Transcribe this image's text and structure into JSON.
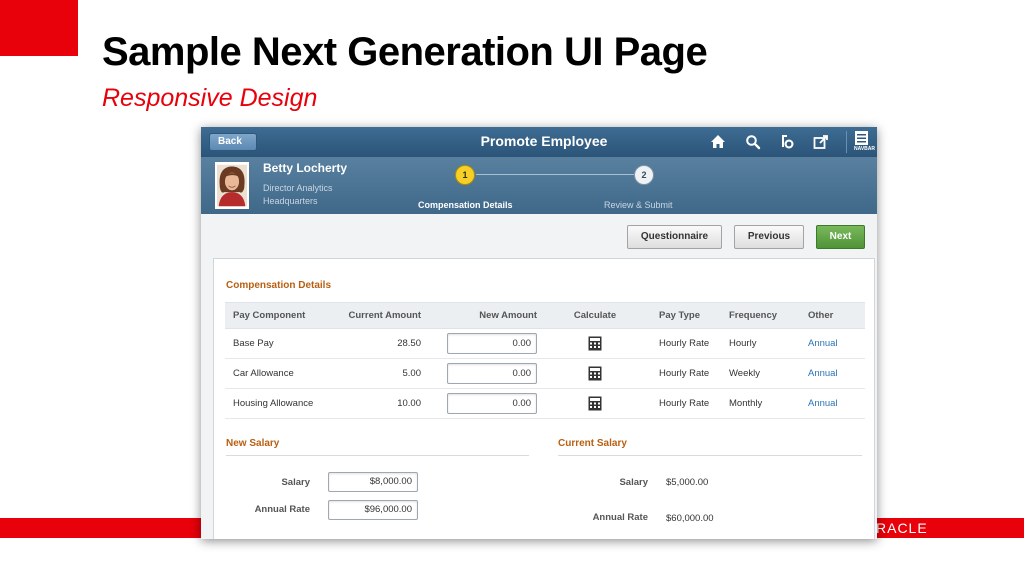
{
  "slide": {
    "title": "Sample Next Generation UI Page",
    "subtitle": "Responsive Design",
    "brand": "RACLE",
    "accent_color": "#e8000a"
  },
  "app": {
    "navbar": {
      "back_label": "Back",
      "title": "Promote Employee",
      "icons": [
        "home-icon",
        "search-icon",
        "notifications-icon",
        "actions-icon"
      ],
      "navbar_label": "NAVBAR"
    },
    "employee": {
      "name": "Betty Locherty",
      "role": "Director Analytics",
      "location": "Headquarters"
    },
    "train": {
      "steps": [
        {
          "number": "1",
          "label": "Compensation Details",
          "active": true
        },
        {
          "number": "2",
          "label": "Review & Submit",
          "active": false
        }
      ]
    },
    "toolbar": {
      "questionnaire_label": "Questionnaire",
      "previous_label": "Previous",
      "next_label": "Next"
    },
    "compensation": {
      "title": "Compensation Details",
      "columns": [
        "Pay Component",
        "Current Amount",
        "New Amount",
        "Calculate",
        "Pay Type",
        "Frequency",
        "Other"
      ],
      "rows": [
        {
          "component": "Base Pay",
          "current": "28.50",
          "new_amount": "0.00",
          "pay_type": "Hourly Rate",
          "frequency": "Hourly",
          "other": "Annual"
        },
        {
          "component": "Car Allowance",
          "current": "5.00",
          "new_amount": "0.00",
          "pay_type": "Hourly Rate",
          "frequency": "Weekly",
          "other": "Annual"
        },
        {
          "component": "Housing Allowance",
          "current": "10.00",
          "new_amount": "0.00",
          "pay_type": "Hourly Rate",
          "frequency": "Monthly",
          "other": "Annual"
        }
      ]
    },
    "new_salary": {
      "title": "New Salary",
      "salary_label": "Salary",
      "salary_value": "$8,000.00",
      "annual_label": "Annual Rate",
      "annual_value": "$96,000.00"
    },
    "current_salary": {
      "title": "Current Salary",
      "salary_label": "Salary",
      "salary_value": "$5,000.00",
      "annual_label": "Annual Rate",
      "annual_value": "$60,000.00"
    }
  }
}
